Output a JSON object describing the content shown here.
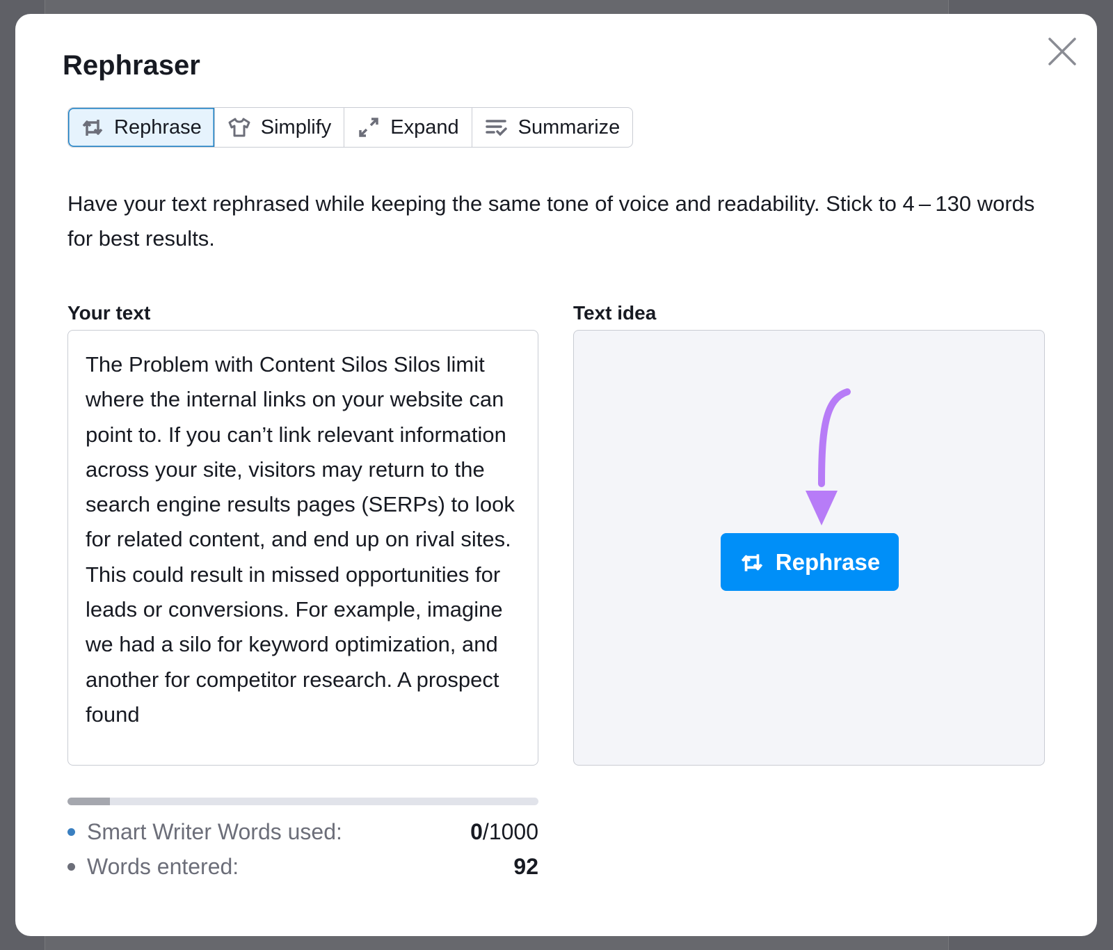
{
  "modal": {
    "title": "Rephraser",
    "close_icon": "close-icon"
  },
  "tabs": [
    {
      "label": "Rephrase",
      "icon": "rephrase-icon",
      "active": true
    },
    {
      "label": "Simplify",
      "icon": "tshirt-icon",
      "active": false
    },
    {
      "label": "Expand",
      "icon": "expand-icon",
      "active": false
    },
    {
      "label": "Summarize",
      "icon": "summarize-icon",
      "active": false
    }
  ],
  "description": "Have your text rephrased while keeping the same tone of voice and readability. Stick to 4 – 130 words for best results.",
  "your_text": {
    "label": "Your text",
    "value": "The Problem with Content Silos Silos limit where the internal links on your website can point to. If you can’t link relevant information across your site, visitors may return to the search engine results pages (SERPs) to look for related content, and end up on rival sites. This could result in missed opportunities for leads or conversions. For example, imagine we had a silo for keyword optimization, and another for competitor research. A prospect found"
  },
  "text_idea": {
    "label": "Text idea",
    "button_label": "Rephrase"
  },
  "usage": {
    "progress_percent": 9,
    "smart_writer_label": "Smart Writer Words used:",
    "used": "0",
    "limit": "/1000",
    "words_entered_label": "Words entered:",
    "words_entered": "92"
  },
  "colors": {
    "accent": "#008ff8",
    "arrow": "#b77cf7",
    "active_tab_bg": "#e6f3fd",
    "dot_blue": "#3a7fc0",
    "dot_gray": "#6c6e79"
  }
}
